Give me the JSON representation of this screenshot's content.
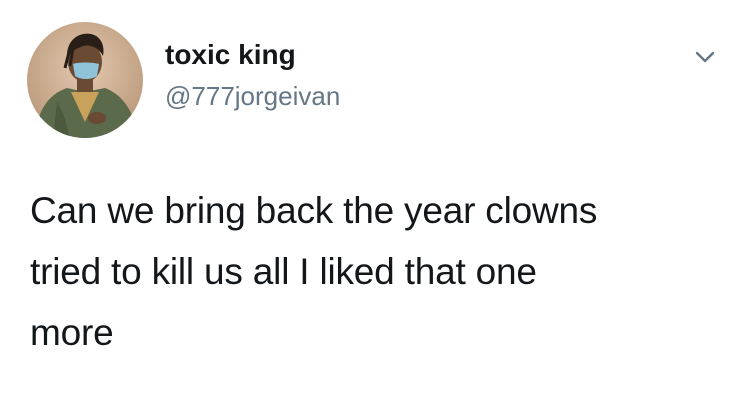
{
  "tweet": {
    "author": {
      "display_name": "toxic king",
      "handle": "@777jorgeivan",
      "avatar_icon": "profile-photo"
    },
    "menu_icon": "chevron-down-icon",
    "text": "Can we bring back the year clowns\ntried to kill us all I liked that one\nmore"
  },
  "colors": {
    "text_primary": "#14171a",
    "text_secondary": "#657786",
    "background": "#ffffff"
  }
}
